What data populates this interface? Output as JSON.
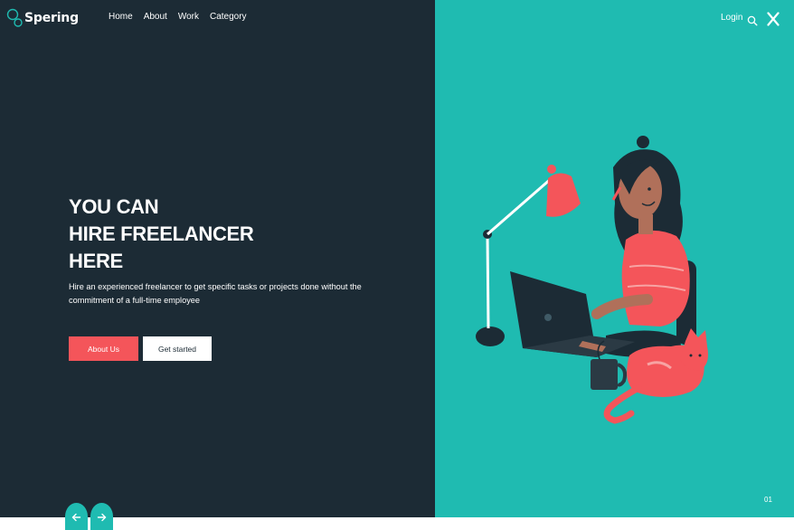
{
  "brand": {
    "name": "Spering",
    "accent": "#1fbbb1",
    "dark": "#1c2b35",
    "coral": "#f4555a"
  },
  "nav": {
    "items": [
      {
        "label": "Home"
      },
      {
        "label": "About"
      },
      {
        "label": "Work"
      },
      {
        "label": "Category"
      }
    ],
    "login": "Login",
    "search_icon": "search-icon",
    "close_icon": "close-icon"
  },
  "hero": {
    "title_lines": [
      "YOU CAN",
      "HIRE FREELANCER",
      "HERE"
    ],
    "description": "Hire an experienced freelancer to get specific tasks or projects done without the commitment of a full-time employee",
    "buttons": {
      "about": "About Us",
      "start": "Get started"
    }
  },
  "slider": {
    "current": "01",
    "prev_icon": "arrow-left-icon",
    "next_icon": "arrow-right-icon"
  }
}
